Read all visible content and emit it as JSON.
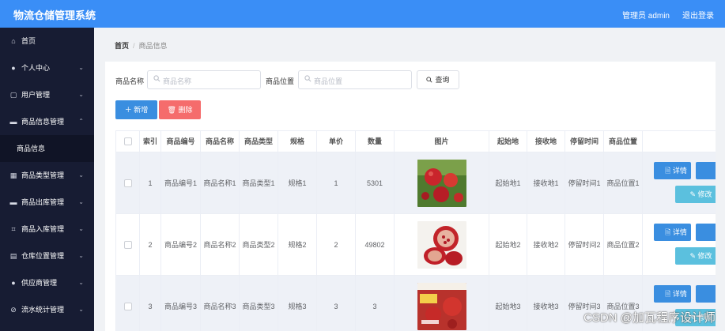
{
  "header": {
    "title": "物流仓储管理系统",
    "user": "管理员 admin",
    "logout": "退出登录"
  },
  "sidebar": {
    "items": [
      {
        "label": "首页",
        "icon": "home-icon",
        "glyph": "⌂",
        "arrow": ""
      },
      {
        "label": "个人中心",
        "icon": "user-icon",
        "glyph": "●",
        "arrow": "⌄"
      },
      {
        "label": "用户管理",
        "icon": "copy-icon",
        "glyph": "▢",
        "arrow": "⌄"
      },
      {
        "label": "商品信息管理",
        "icon": "monitor-icon",
        "glyph": "▬",
        "arrow": "⌃"
      },
      {
        "label": "商品信息",
        "icon": "",
        "glyph": "",
        "arrow": ""
      },
      {
        "label": "商品类型管理",
        "icon": "grid-icon",
        "glyph": "▦",
        "arrow": "⌄"
      },
      {
        "label": "商品出库管理",
        "icon": "monitor-icon",
        "glyph": "▬",
        "arrow": "⌄"
      },
      {
        "label": "商品入库管理",
        "icon": "crop-icon",
        "glyph": "⌗",
        "arrow": "⌄"
      },
      {
        "label": "仓库位置管理",
        "icon": "warehouse-icon",
        "glyph": "▤",
        "arrow": "⌄"
      },
      {
        "label": "供应商管理",
        "icon": "user-icon",
        "glyph": "●",
        "arrow": "⌄"
      },
      {
        "label": "流水统计管理",
        "icon": "chart-icon",
        "glyph": "⊘",
        "arrow": "⌄"
      }
    ]
  },
  "breadcrumb": {
    "home": "首页",
    "sep": "/",
    "current": "商品信息"
  },
  "search": {
    "name_label": "商品名称",
    "name_placeholder": "商品名称",
    "loc_label": "商品位置",
    "loc_placeholder": "商品位置",
    "query_button": "查询"
  },
  "actions": {
    "add": "新增",
    "delete": "删除"
  },
  "table": {
    "columns": [
      "",
      "索引",
      "商品编号",
      "商品名称",
      "商品类型",
      "规格",
      "单价",
      "数量",
      "图片",
      "起始地",
      "接收地",
      "停留时间",
      "商品位置",
      ""
    ],
    "rows": [
      {
        "idx": "1",
        "code": "商品编号1",
        "name": "商品名称1",
        "type": "商品类型1",
        "spec": "规格1",
        "price": "1",
        "qty": "5301",
        "origin": "起始地1",
        "dest": "接收地1",
        "stay": "停留时间1",
        "loc": "商品位置1",
        "detail": "详情",
        "edit": "修改"
      },
      {
        "idx": "2",
        "code": "商品编号2",
        "name": "商品名称2",
        "type": "商品类型2",
        "spec": "规格2",
        "price": "2",
        "qty": "49802",
        "origin": "起始地2",
        "dest": "接收地2",
        "stay": "停留时间2",
        "loc": "商品位置2",
        "detail": "详情",
        "edit": "修改"
      },
      {
        "idx": "3",
        "code": "商品编号3",
        "name": "商品名称3",
        "type": "商品类型3",
        "spec": "规格3",
        "price": "3",
        "qty": "3",
        "origin": "起始地3",
        "dest": "接收地3",
        "stay": "停留时间3",
        "loc": "商品位置3",
        "detail": "详情",
        "edit": "修改"
      }
    ]
  },
  "colors": {
    "header": "#3a8ef6",
    "sidebar": "#171c33",
    "primary": "#3a8ee0",
    "danger": "#f56c6c",
    "info": "#5bc0de"
  },
  "watermark": "CSDN @加瓦程序设计师"
}
